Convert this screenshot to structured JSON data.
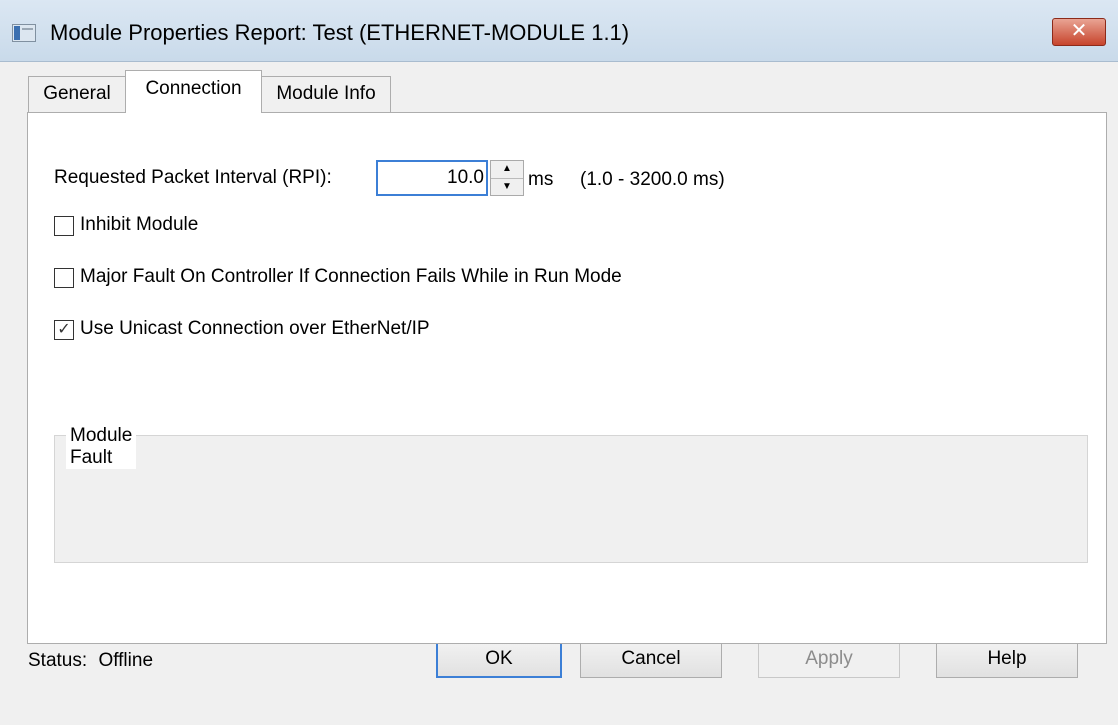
{
  "window": {
    "title": "Module Properties Report: Test (ETHERNET-MODULE 1.1)",
    "close_glyph": "✕"
  },
  "tabs": [
    {
      "label": "General",
      "active": false
    },
    {
      "label": "Connection",
      "active": true
    },
    {
      "label": "Module Info",
      "active": false
    }
  ],
  "connection": {
    "rpi_label": "Requested Packet Interval (RPI):",
    "rpi_value": "10.0",
    "rpi_unit": "ms",
    "rpi_range": "(1.0 - 3200.0 ms)",
    "checkboxes": [
      {
        "label": "Inhibit Module",
        "checked": false
      },
      {
        "label": "Major Fault On Controller If Connection Fails While in Run Mode",
        "checked": false
      },
      {
        "label": "Use Unicast Connection over EtherNet/IP",
        "checked": true
      }
    ],
    "module_fault_label": "Module Fault"
  },
  "footer": {
    "status_label": "Status:",
    "status_value": "Offline",
    "buttons": {
      "ok": "OK",
      "cancel": "Cancel",
      "apply": "Apply",
      "help": "Help"
    }
  },
  "colors": {
    "focus_border": "#3c7fd6",
    "close_button": "#c7442c"
  }
}
